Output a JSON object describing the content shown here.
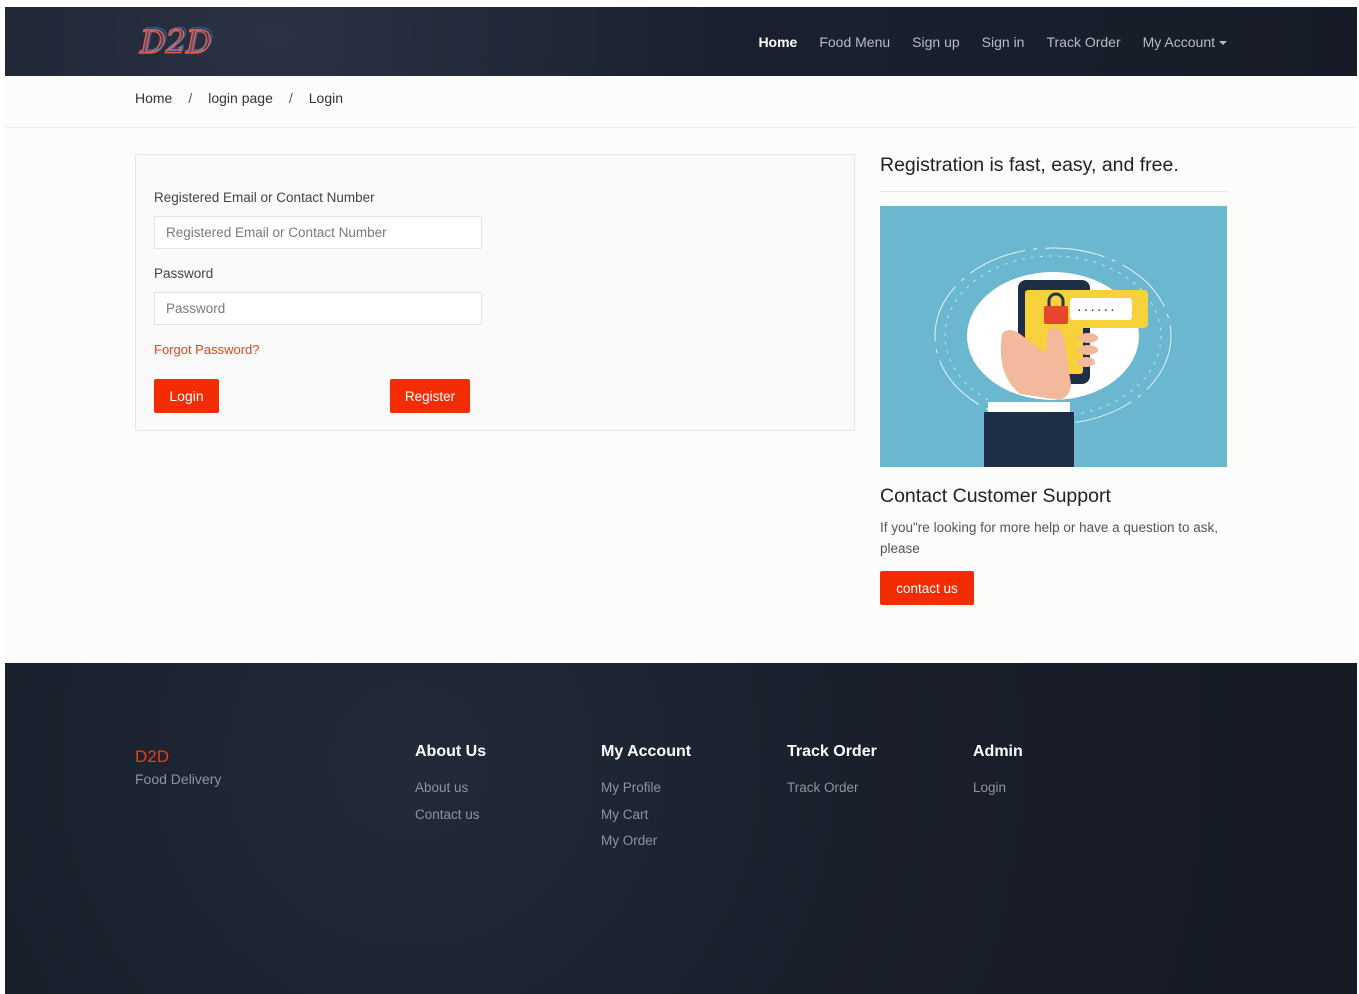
{
  "nav": {
    "logo_text": "D2D",
    "links": [
      "Home",
      "Food Menu",
      "Sign up",
      "Sign in",
      "Track Order"
    ],
    "account_label": "My Account"
  },
  "breadcrumb": [
    "Home",
    "login page",
    "Login"
  ],
  "login": {
    "email_label": "Registered Email or Contact Number",
    "email_placeholder": "Registered Email or Contact Number",
    "password_label": "Password",
    "password_placeholder": "Password",
    "forgot": "Forgot Password?",
    "login_button": "Login",
    "register_button": "Register"
  },
  "sidebar": {
    "title": "Registration is fast, easy, and free.",
    "support_title": "Contact Customer Support",
    "support_text": "If you\"re looking for more help or have a question to ask, please",
    "contact_button": "contact us"
  },
  "footer": {
    "brand": "D2D",
    "brand_sub": "Food Delivery",
    "columns": [
      {
        "title": "About Us",
        "links": [
          "About us",
          "Contact us"
        ]
      },
      {
        "title": "My Account",
        "links": [
          "My Profile",
          "My Cart",
          "My Order"
        ]
      },
      {
        "title": "Track Order",
        "links": [
          "Track Order"
        ]
      },
      {
        "title": "Admin",
        "links": [
          "Login"
        ]
      }
    ]
  },
  "colors": {
    "accent": "#f42c04",
    "navbar": "#1b2130",
    "illustration_bg": "#6ab7cf"
  }
}
